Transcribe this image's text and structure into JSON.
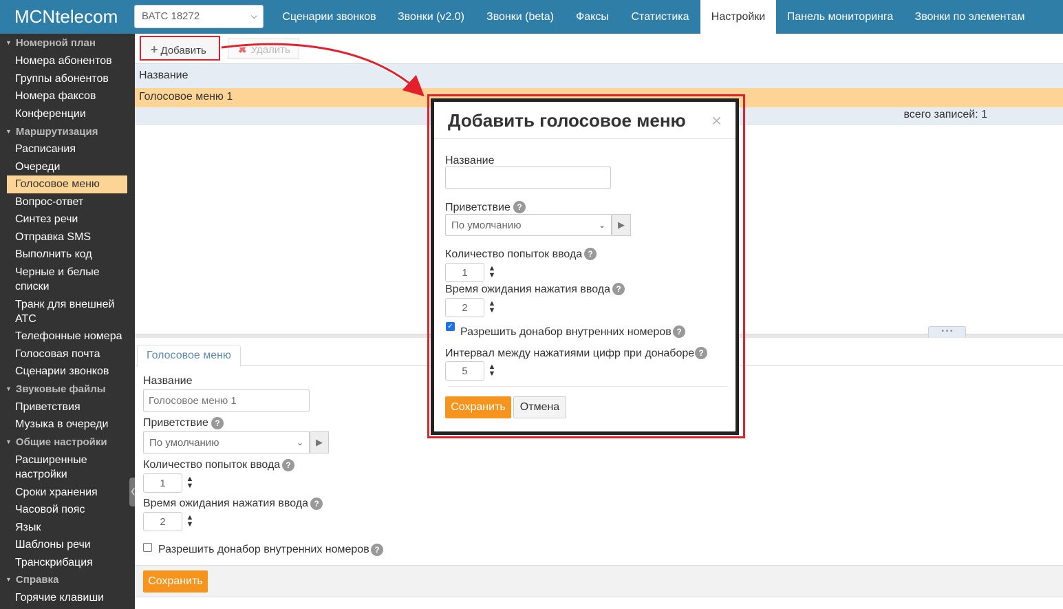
{
  "header": {
    "logo": "MCNtelecom",
    "pbx_select": "ВАТС 18272",
    "tabs": [
      {
        "label": "Сценарии звонков"
      },
      {
        "label": "Звонки (v2.0)"
      },
      {
        "label": "Звонки (beta)"
      },
      {
        "label": "Факсы"
      },
      {
        "label": "Статистика"
      },
      {
        "label": "Настройки",
        "active": true
      },
      {
        "label": "Панель мониторинга"
      },
      {
        "label": "Звонки по элементам"
      }
    ]
  },
  "sidebar": {
    "sections": [
      {
        "title": "Номерной план",
        "items": [
          "Номера абонентов",
          "Группы абонентов",
          "Номера факсов",
          "Конференции"
        ]
      },
      {
        "title": "Маршрутизация",
        "items": [
          "Расписания",
          "Очереди",
          "Голосовое меню",
          "Вопрос-ответ",
          "Синтез речи",
          "Отправка SMS",
          "Выполнить код",
          "Черные и белые",
          "списки",
          "Транк для внешней",
          "АТС",
          "Телефонные номера",
          "Голосовая почта",
          "Сценарии звонков"
        ]
      },
      {
        "title": "Звуковые файлы",
        "items": [
          "Приветствия",
          "Музыка в очереди"
        ]
      },
      {
        "title": "Общие настройки",
        "items": [
          "Расширенные",
          "настройки",
          "Сроки хранения",
          "Часовой пояс",
          "Язык",
          "Шаблоны речи",
          "Транскрибация"
        ]
      },
      {
        "title": "Справка",
        "items": [
          "Горячие клавиши"
        ]
      }
    ],
    "active_item": "Голосовое меню"
  },
  "toolbar": {
    "add_label": "Добавить",
    "delete_label": "Удалить"
  },
  "grid": {
    "column_header": "Название",
    "rows": [
      "Голосовое меню 1"
    ],
    "footer": "всего записей: 1"
  },
  "detail": {
    "tab_label": "Голосовое меню",
    "name_label": "Название",
    "name_value": "Голосовое меню 1",
    "greeting_label": "Приветствие",
    "greeting_value": "По умолчанию",
    "attempts_label": "Количество попыток ввода",
    "attempts_value": "1",
    "wait_label": "Время ожидания нажатия ввода",
    "wait_value": "2",
    "allow_dial_label": "Разрешить донабор внутренних номеров",
    "allow_dial_checked": false,
    "save_label": "Сохранить"
  },
  "modal": {
    "title": "Добавить голосовое меню",
    "close": "×",
    "name_label": "Название",
    "name_value": "",
    "greeting_label": "Приветствие",
    "greeting_value": "По умолчанию",
    "attempts_label": "Количество попыток ввода",
    "attempts_value": "1",
    "wait_label": "Время ожидания нажатия ввода",
    "wait_value": "2",
    "allow_dial_label": "Разрешить донабор внутренних номеров",
    "allow_dial_checked": true,
    "interval_label": "Интервал между нажатиями цифр при донаборе",
    "interval_value": "5",
    "save_label": "Сохранить",
    "cancel_label": "Отмена"
  },
  "help_glyph": "?",
  "colors": {
    "header_bg": "#2f7ea8",
    "sidebar_bg": "#333333",
    "highlight": "#fcd596",
    "accent_button": "#f7941d",
    "annotation_red": "#e4202a"
  }
}
